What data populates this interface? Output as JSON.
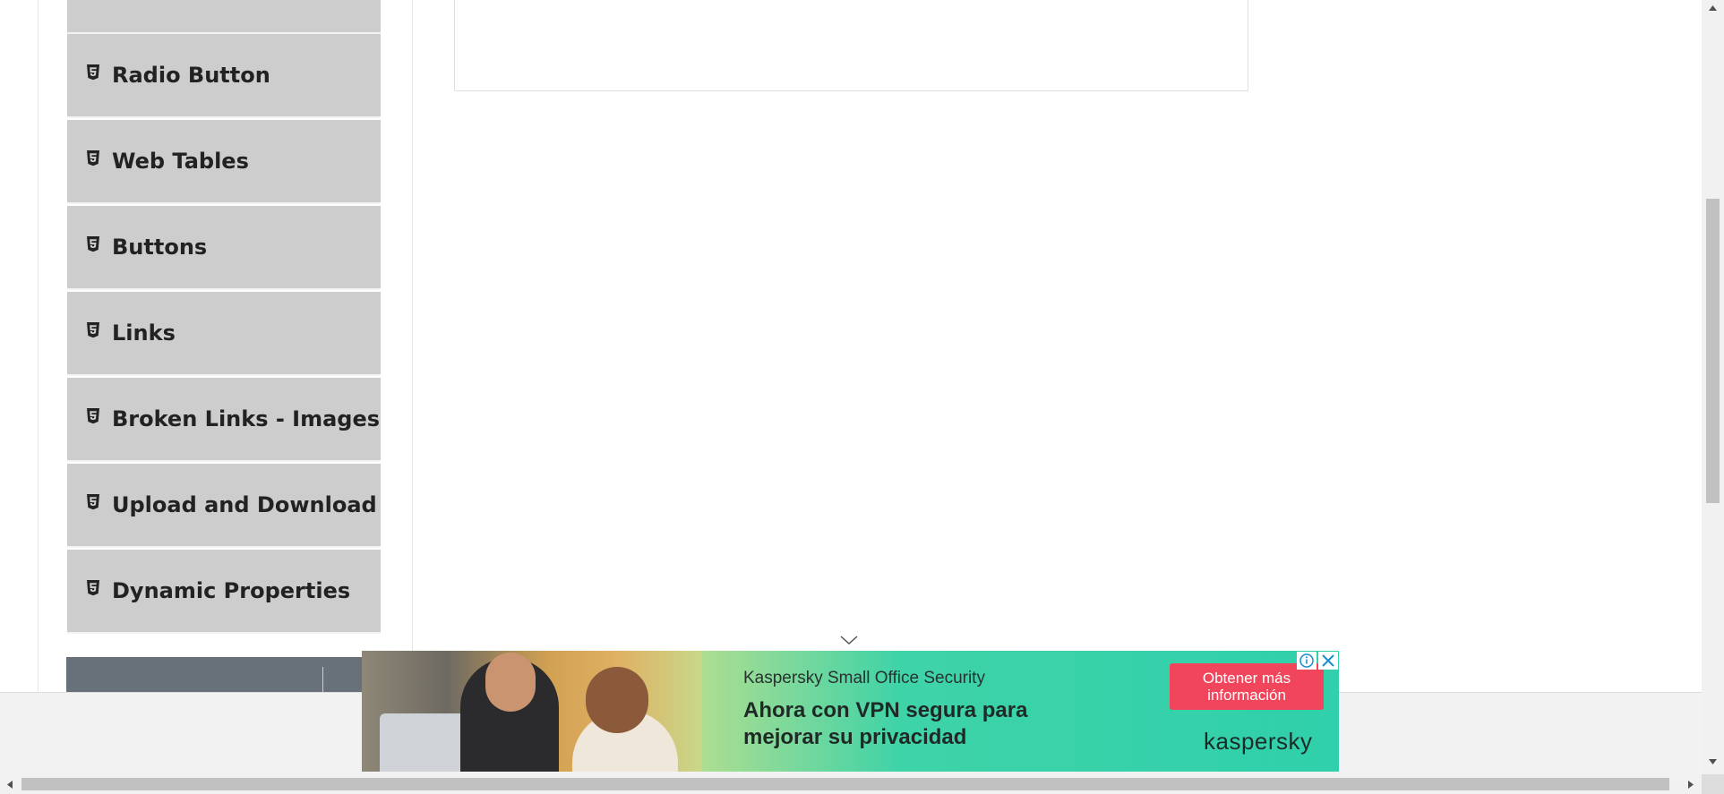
{
  "sidebar": {
    "items": [
      {
        "label": "Radio Button",
        "icon": "html5-icon"
      },
      {
        "label": "Web Tables",
        "icon": "html5-icon"
      },
      {
        "label": "Buttons",
        "icon": "html5-icon"
      },
      {
        "label": "Links",
        "icon": "html5-icon"
      },
      {
        "label": "Broken Links - Images",
        "icon": "html5-icon"
      },
      {
        "label": "Upload and Download",
        "icon": "html5-icon"
      },
      {
        "label": "Dynamic Properties",
        "icon": "html5-icon"
      }
    ]
  },
  "ad": {
    "brandline": "Kaspersky Small Office Security",
    "headline": "Ahora con VPN segura para mejorar su privacidad",
    "cta": "Obtener más información",
    "logo": "kaspersky",
    "colors": {
      "cta": "#f0455a",
      "teal": "#2fd0ab"
    }
  },
  "colors": {
    "menu_bg": "#cdcdcd",
    "group_header": "#68717a"
  }
}
